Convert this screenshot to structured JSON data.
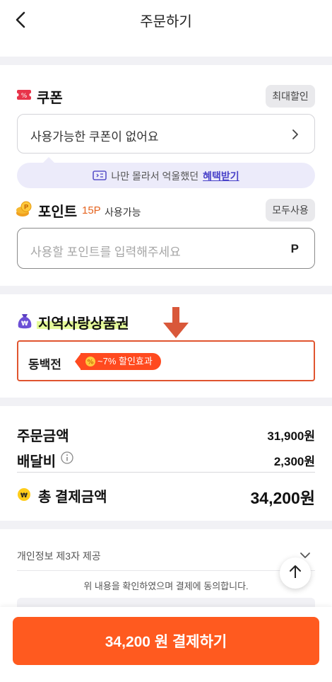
{
  "header": {
    "title": "주문하기"
  },
  "coupon": {
    "title": "쿠폰",
    "max_discount_label": "최대할인",
    "empty_text": "사용가능한 쿠폰이 없어요",
    "benefit_prefix": "나만 몰라서 억울했던",
    "benefit_link": "혜택받기"
  },
  "point": {
    "title": "포인트",
    "available_amount": "15P",
    "available_label": "사용가능",
    "use_all_label": "모두사용",
    "placeholder": "사용할 포인트를 입력해주세요",
    "unit": "P"
  },
  "local_voucher": {
    "title": "지역사랑상품권",
    "option_label": "동백전",
    "discount_tag": "~7% 할인효과"
  },
  "summary": {
    "order_label": "주문금액",
    "order_amount": "31,900원",
    "delivery_label": "배달비",
    "delivery_amount": "2,300원",
    "total_label": "총 결제금액",
    "total_amount": "34,200원"
  },
  "agreement": {
    "third_party_label": "개인정보 제3자 제공",
    "consent_text": "위 내용을 확인하였으며 결제에 동의합니다."
  },
  "pay_button": {
    "label": "34,200 원 결제하기"
  },
  "colors": {
    "accent": "#ff5a1f",
    "highlight_border": "#e0552f",
    "benefit_bg": "#ecebfa",
    "link": "#4a43c9"
  }
}
